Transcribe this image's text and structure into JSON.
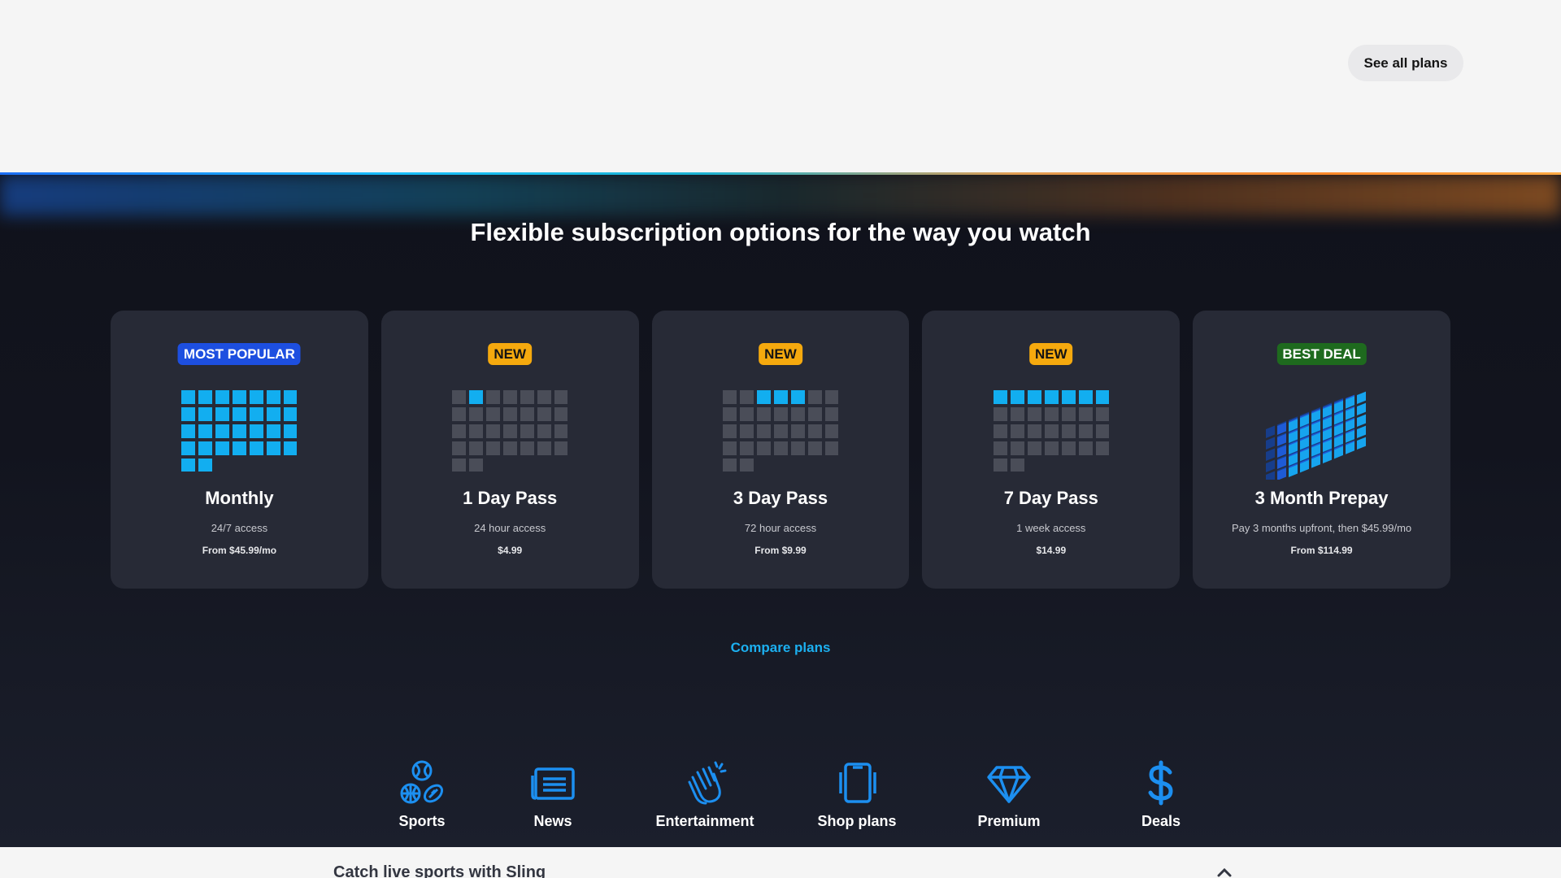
{
  "header": {
    "see_all_plans_label": "See all plans"
  },
  "section": {
    "title": "Flexible subscription options for the way you watch"
  },
  "colors": {
    "accent": "#1cb0f0",
    "card": "#272a36",
    "popular": "#1d4fe0",
    "new": "#f5a90e",
    "best": "#1e6a1e"
  },
  "plans": [
    {
      "badge": "MOST POPULAR",
      "badge_type": "popular",
      "name": "Monthly",
      "sub": "24/7 access",
      "price": "From $45.99/mo",
      "active_days": 30
    },
    {
      "badge": "NEW",
      "badge_type": "new",
      "name": "1 Day Pass",
      "sub": "24 hour access",
      "price": "$4.99",
      "active_days": 1
    },
    {
      "badge": "NEW",
      "badge_type": "new",
      "name": "3 Day Pass",
      "sub": "72 hour access",
      "price": "From $9.99",
      "active_days": 3
    },
    {
      "badge": "NEW",
      "badge_type": "new",
      "name": "7 Day Pass",
      "sub": "1 week access",
      "price": "$14.99",
      "active_days": 7
    },
    {
      "badge": "BEST DEAL",
      "badge_type": "best",
      "name": "3 Month Prepay",
      "sub": "Pay 3 months upfront, then $45.99/mo",
      "price": "From $114.99",
      "active_days": 90
    }
  ],
  "compare_label": "Compare plans",
  "categories": [
    {
      "label": "Sports",
      "icon": "sports-balls-icon"
    },
    {
      "label": "News",
      "icon": "newspaper-icon"
    },
    {
      "label": "Entertainment",
      "icon": "clapping-hands-icon"
    },
    {
      "label": "Shop plans",
      "icon": "device-icon"
    },
    {
      "label": "Premium",
      "icon": "diamond-icon"
    },
    {
      "label": "Deals",
      "icon": "dollar-icon"
    }
  ],
  "bottom": {
    "title": "Catch live sports with Sling"
  }
}
